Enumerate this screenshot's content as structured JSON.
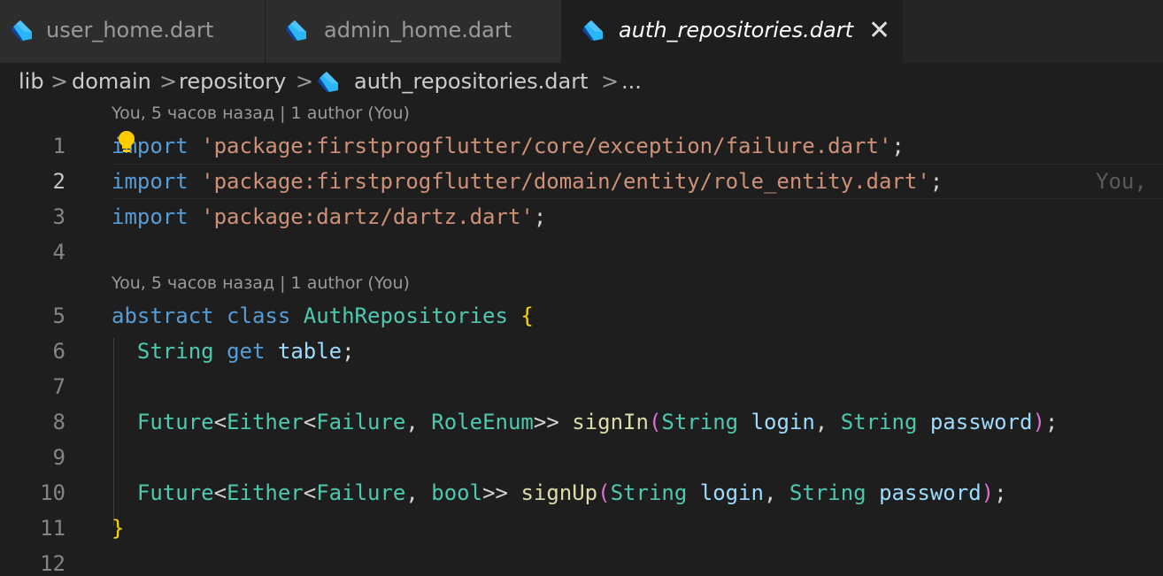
{
  "tabs": [
    {
      "label": "user_home.dart",
      "icon": "dart-file-icon",
      "active": false
    },
    {
      "label": "admin_home.dart",
      "icon": "dart-file-icon",
      "active": false
    },
    {
      "label": "auth_repositories.dart",
      "icon": "dart-file-icon",
      "active": true,
      "close_glyph": "✕"
    }
  ],
  "breadcrumb": {
    "items": [
      "lib",
      "domain",
      "repository",
      "auth_repositories.dart",
      "..."
    ],
    "separator": ">"
  },
  "codelens": [
    "You, 5 часов назад | 1 author (You)",
    "You, 5 часов назад | 1 author (You)"
  ],
  "line_numbers": [
    "1",
    "2",
    "3",
    "4",
    "5",
    "6",
    "7",
    "8",
    "9",
    "10",
    "11",
    "12"
  ],
  "code": {
    "l1": {
      "kw": "import",
      "str": "'package:firstprogflutter/core/exception/failure.dart'",
      "end": ";"
    },
    "l2": {
      "kw": "import",
      "str": "'package:firstprogflutter/domain/entity/role_entity.dart'",
      "end": ";"
    },
    "l3": {
      "kw": "import",
      "str": "'package:dartz/dartz.dart'",
      "end": ";"
    },
    "l5": {
      "kw1": "abstract",
      "kw2": "class",
      "name": "AuthRepositories",
      "brace": "{"
    },
    "l6": {
      "type": "String",
      "kw": "get",
      "name": "table",
      "end": ";"
    },
    "l8": {
      "future": "Future",
      "either": "Either",
      "failure": "Failure",
      "ret": "RoleEnum",
      "fn": "signIn",
      "t1": "String",
      "p1": "login",
      "t2": "String",
      "p2": "password",
      "end": ";"
    },
    "l10": {
      "future": "Future",
      "either": "Either",
      "failure": "Failure",
      "ret": "bool",
      "fn": "signUp",
      "t1": "String",
      "p1": "login",
      "t2": "String",
      "p2": "password",
      "end": ";"
    },
    "l11": {
      "brace": "}"
    }
  },
  "inline_blame": "You,",
  "colors": {
    "background": "#1e1e1e",
    "keyword": "#569cd6",
    "string": "#ce9178",
    "type": "#4ec9b0",
    "function": "#dcdcaa",
    "variable": "#9cdcfe",
    "bracket_gold": "#ffd700",
    "bracket_purple": "#da70d6",
    "dart_icon": "#29b6f6"
  }
}
